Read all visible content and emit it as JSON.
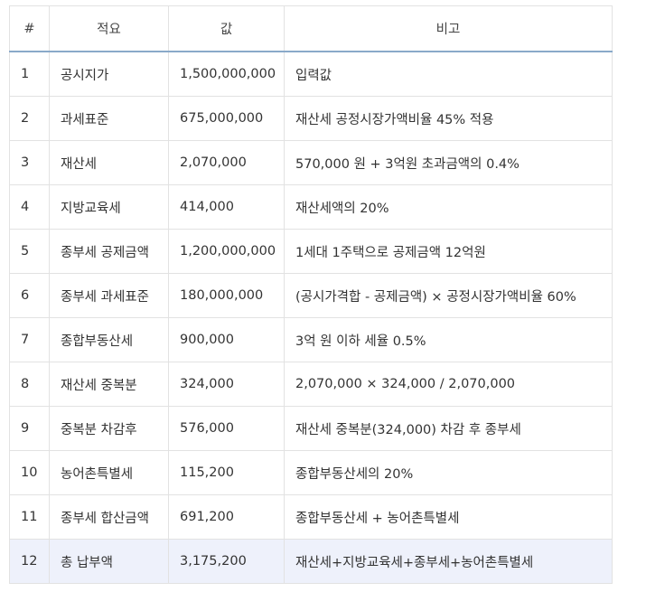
{
  "headers": [
    "#",
    "적요",
    "값",
    "비고"
  ],
  "rows": [
    {
      "no": "1",
      "item": "공시지가",
      "value": "1,500,000,000",
      "note": "입력값"
    },
    {
      "no": "2",
      "item": "과세표준",
      "value": "675,000,000",
      "note": "재산세 공정시장가액비율 45% 적용"
    },
    {
      "no": "3",
      "item": "재산세",
      "value": "2,070,000",
      "note": "570,000 원 + 3억원 초과금액의 0.4%"
    },
    {
      "no": "4",
      "item": "지방교육세",
      "value": "414,000",
      "note": "재산세액의 20%"
    },
    {
      "no": "5",
      "item": "종부세 공제금액",
      "value": "1,200,000,000",
      "note": "1세대 1주택으로 공제금액 12억원"
    },
    {
      "no": "6",
      "item": "종부세 과세표준",
      "value": "180,000,000",
      "note": "(공시가격합 - 공제금액) × 공정시장가액비율 60%"
    },
    {
      "no": "7",
      "item": "종합부동산세",
      "value": "900,000",
      "note": "3억 원 이하 세율 0.5%"
    },
    {
      "no": "8",
      "item": "재산세 중복분",
      "value": "324,000",
      "note": "2,070,000 × 324,000 / 2,070,000"
    },
    {
      "no": "9",
      "item": "중복분 차감후",
      "value": "576,000",
      "note": "재산세 중복분(324,000) 차감 후 종부세"
    },
    {
      "no": "10",
      "item": "농어촌특별세",
      "value": "115,200",
      "note": "종합부동산세의 20%"
    },
    {
      "no": "11",
      "item": "종부세 합산금액",
      "value": "691,200",
      "note": "종합부동산세 + 농어촌특별세"
    },
    {
      "no": "12",
      "item": "총 납부액",
      "value": "3,175,200",
      "note": "재산세+지방교육세+종부세+농어촌특별세"
    }
  ],
  "highlight_row_color": "#eef1fb",
  "header_rule_color": "#8aa9c9"
}
